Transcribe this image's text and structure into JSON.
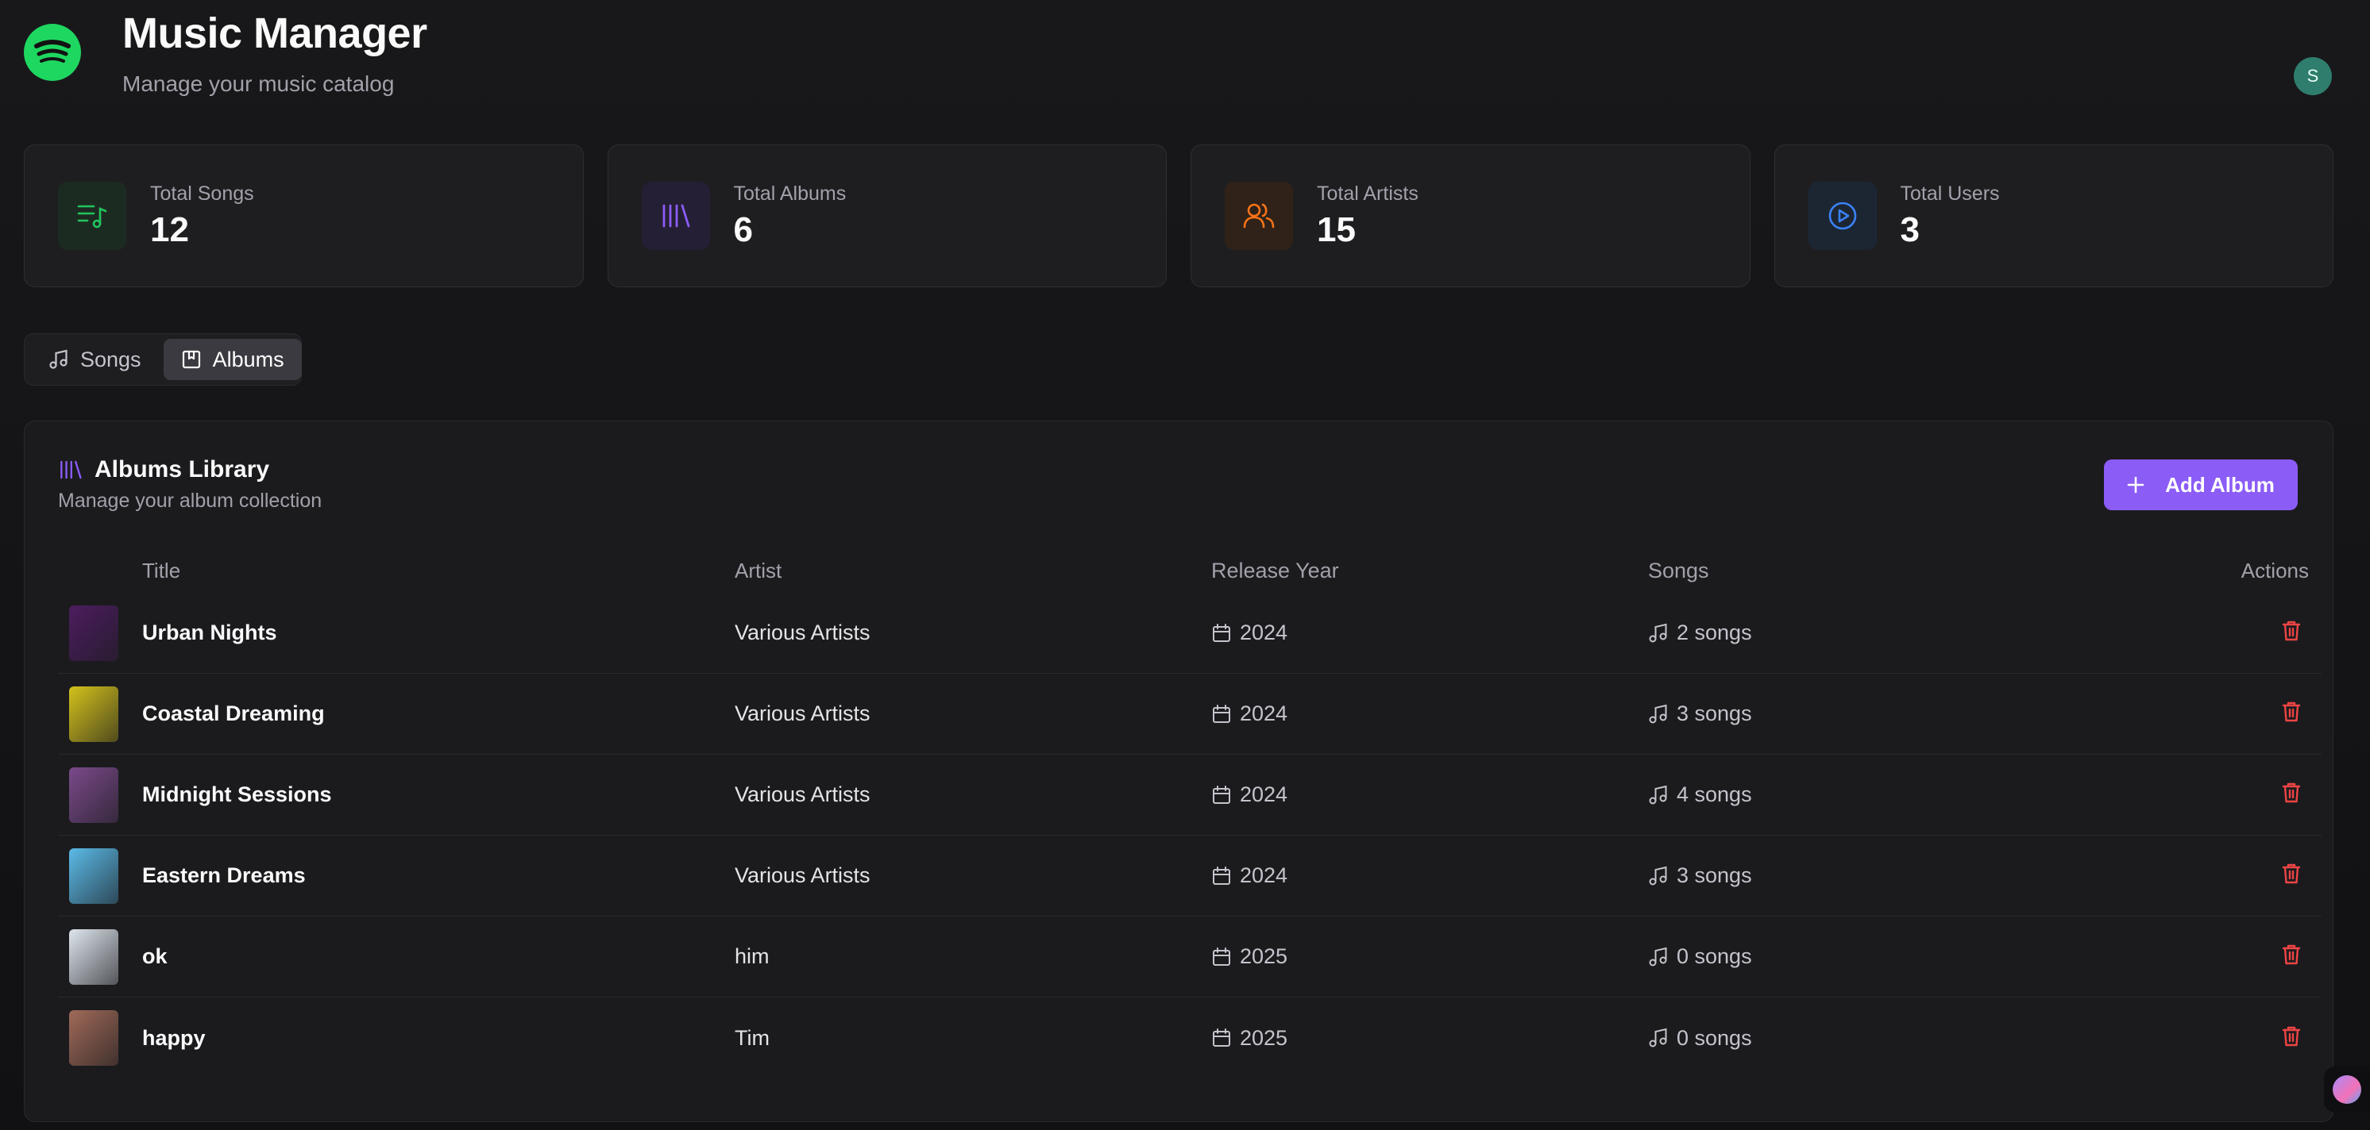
{
  "header": {
    "title": "Music Manager",
    "subtitle": "Manage your music catalog",
    "avatar_initial": "S"
  },
  "stats": [
    {
      "label": "Total Songs",
      "value": "12",
      "icon": "playlist-music-icon",
      "color": "#22c55e"
    },
    {
      "label": "Total Albums",
      "value": "6",
      "icon": "library-icon",
      "color": "#8b5cf6"
    },
    {
      "label": "Total Artists",
      "value": "15",
      "icon": "users-icon",
      "color": "#f97316"
    },
    {
      "label": "Total Users",
      "value": "3",
      "icon": "play-circle-icon",
      "color": "#3b82f6"
    }
  ],
  "tabs": [
    {
      "label": "Songs",
      "icon": "music-note-icon",
      "active": false
    },
    {
      "label": "Albums",
      "icon": "album-icon",
      "active": true
    }
  ],
  "panel": {
    "title": "Albums Library",
    "description": "Manage your album collection",
    "add_button": "Add Album"
  },
  "table": {
    "headers": {
      "title": "Title",
      "artist": "Artist",
      "year": "Release Year",
      "songs": "Songs",
      "actions": "Actions"
    },
    "rows": [
      {
        "title": "Urban Nights",
        "artist": "Various Artists",
        "year": "2024",
        "songs": "2 songs",
        "cover": "#4c1d5f"
      },
      {
        "title": "Coastal Dreaming",
        "artist": "Various Artists",
        "year": "2024",
        "songs": "3 songs",
        "cover": "#d4c21c"
      },
      {
        "title": "Midnight Sessions",
        "artist": "Various Artists",
        "year": "2024",
        "songs": "4 songs",
        "cover": "#7a4a8a"
      },
      {
        "title": "Eastern Dreams",
        "artist": "Various Artists",
        "year": "2024",
        "songs": "3 songs",
        "cover": "#5bbbe8"
      },
      {
        "title": "ok",
        "artist": "him",
        "year": "2025",
        "songs": "0 songs",
        "cover": "#dfe6ee"
      },
      {
        "title": "happy",
        "artist": "Tim",
        "year": "2025",
        "songs": "0 songs",
        "cover": "#a06a58"
      }
    ]
  },
  "colors": {
    "accent": "#8b5cf6",
    "brand": "#1ed760",
    "danger": "#ef4444"
  }
}
